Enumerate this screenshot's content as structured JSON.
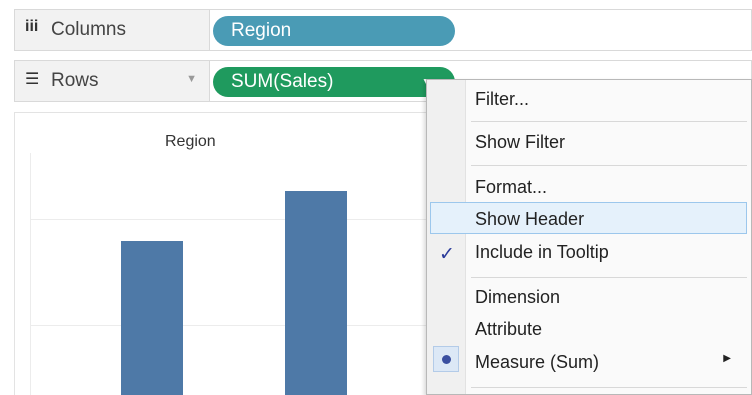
{
  "columns_shelf": {
    "label": "Columns",
    "pill": "Region"
  },
  "rows_shelf": {
    "label": "Rows",
    "pill": "SUM(Sales)"
  },
  "viz": {
    "header": "Region"
  },
  "context_menu": {
    "items": [
      "Filter...",
      "Show Filter",
      "Format...",
      "Show Header",
      "Include in Tooltip",
      "Dimension",
      "Attribute",
      "Measure (Sum)"
    ],
    "highlighted": "Show Header",
    "checked": "Include in Tooltip",
    "selected_radio": "Measure (Sum)"
  },
  "colors": {
    "columns_pill": "#4a9bb5",
    "rows_pill": "#1f9a5e",
    "bar": "#4e79a7",
    "menu_highlight": "#e5f1fb"
  }
}
